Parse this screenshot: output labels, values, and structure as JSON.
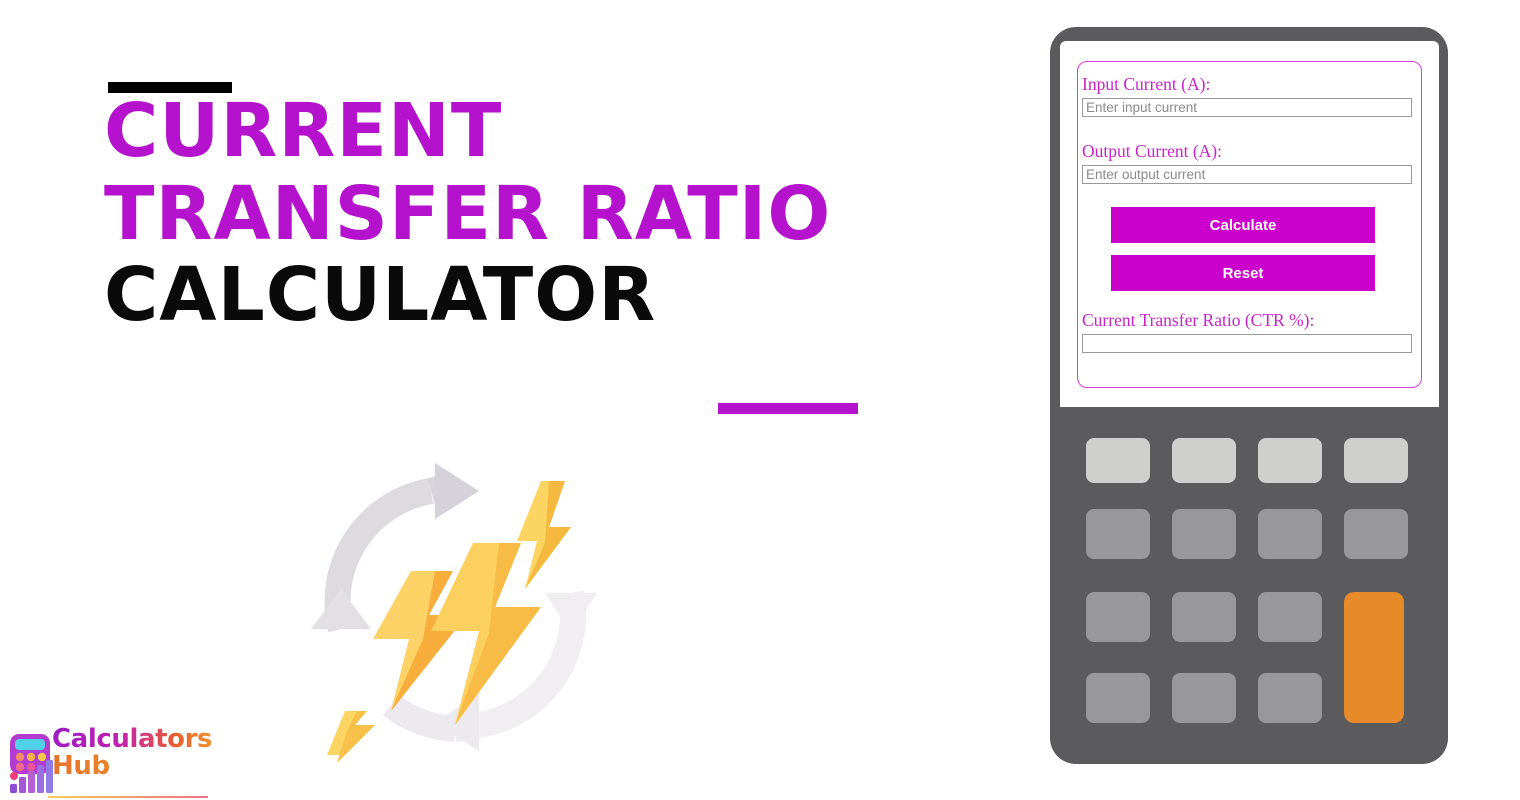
{
  "hero": {
    "title_line1": "CURRENT",
    "title_line2": "TRANSFER RATIO",
    "title_line3": "CALCULATOR",
    "accent_color": "#b512cd",
    "title_line3_color": "#0a0a0a",
    "top_rule_color": "#000000",
    "bottom_rule_color": "#b512cd",
    "illustration": "lightning-bolts-cycle-icon"
  },
  "logo": {
    "word1": "Calculators",
    "word2": "Hub",
    "icon": "calculator-bar-chart-icon",
    "gradient_from": "#9b1ec4",
    "gradient_to": "#f0922b"
  },
  "device": {
    "body_color": "#5b5b5d",
    "screen_color": "#ffffff",
    "form_border_color": "#dd3ade",
    "label_color": "#cc22cc",
    "button_color": "#cc00cc",
    "keypad": {
      "rows": [
        [
          {
            "id": "key-r1c1",
            "style": "light"
          },
          {
            "id": "key-r1c2",
            "style": "light"
          },
          {
            "id": "key-r1c3",
            "style": "light"
          },
          {
            "id": "key-r1c4",
            "style": "light"
          }
        ],
        [
          {
            "id": "key-r2c1",
            "style": "mid"
          },
          {
            "id": "key-r2c2",
            "style": "mid"
          },
          {
            "id": "key-r2c3",
            "style": "mid"
          },
          {
            "id": "key-r2c4",
            "style": "mid"
          }
        ],
        [
          {
            "id": "key-r3c1",
            "style": "mid"
          },
          {
            "id": "key-r3c2",
            "style": "mid"
          },
          {
            "id": "key-r3c3",
            "style": "mid"
          },
          {
            "id": "key-equals-tall",
            "style": "orange"
          }
        ],
        [
          {
            "id": "key-r4c1",
            "style": "mid"
          },
          {
            "id": "key-r4c2",
            "style": "mid"
          },
          {
            "id": "key-r4c3",
            "style": "mid"
          }
        ]
      ],
      "light_color": "#cfcfce",
      "mid_color": "#98989a",
      "orange_color": "#e68a2a"
    }
  },
  "form": {
    "fields": [
      {
        "label": "Input Current (A):",
        "placeholder": "Enter input current",
        "value": ""
      },
      {
        "label": "Output Current (A):",
        "placeholder": "Enter output current",
        "value": ""
      }
    ],
    "calculate_label": "Calculate",
    "reset_label": "Reset",
    "result": {
      "label": "Current Transfer Ratio (CTR %):",
      "value": "",
      "placeholder": ""
    }
  }
}
